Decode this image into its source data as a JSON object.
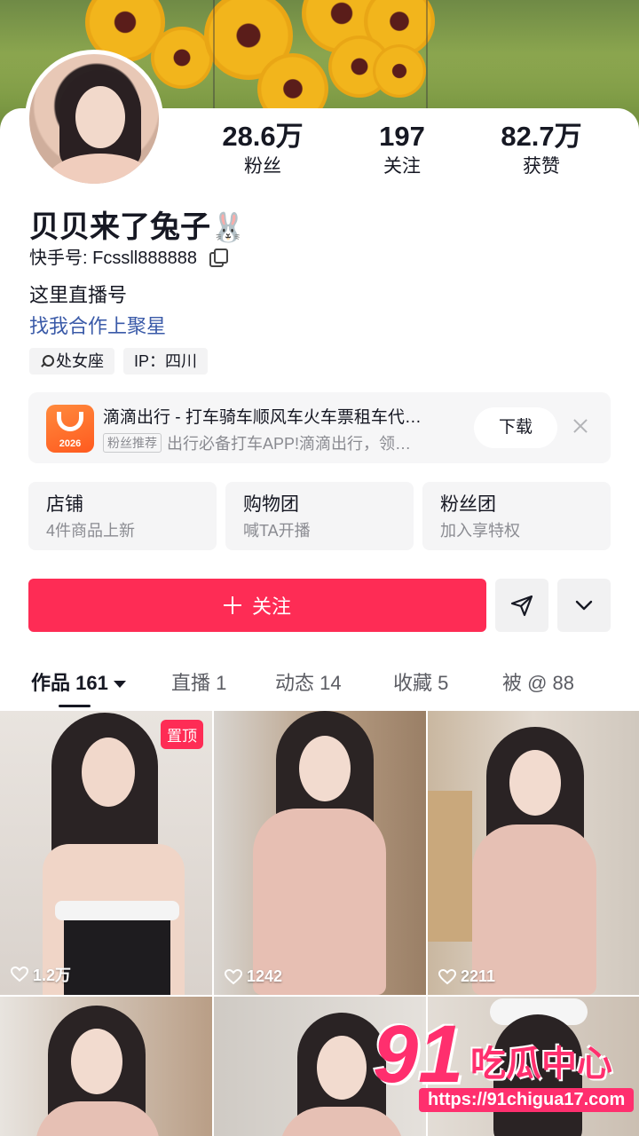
{
  "profile": {
    "name": "贝贝来了兔子",
    "name_emoji": "🐰",
    "kuaishou_id": "快手号: Fcssll888888",
    "bio_line1": "这里直播号",
    "bio_line2": "找我合作上聚星",
    "tags": [
      "处女座",
      "IP：四川"
    ]
  },
  "stats": [
    {
      "value": "28.6万",
      "label": "粉丝"
    },
    {
      "value": "197",
      "label": "关注"
    },
    {
      "value": "82.7万",
      "label": "获赞"
    }
  ],
  "ad": {
    "title": "滴滴出行 - 打车骑车顺风车火车票租车代…",
    "badge": "粉丝推荐",
    "desc": "出行必备打车APP!滴滴出行，领…",
    "button": "下载",
    "logo_year": "2026"
  },
  "features": [
    {
      "title": "店铺",
      "sub": "4件商品上新"
    },
    {
      "title": "购物团",
      "sub": "喊TA开播"
    },
    {
      "title": "粉丝团",
      "sub": "加入享特权"
    }
  ],
  "actions": {
    "follow": "关注"
  },
  "tabs": [
    {
      "label": "作品 161"
    },
    {
      "label": "直播 1"
    },
    {
      "label": "动态 14"
    },
    {
      "label": "收藏 5"
    },
    {
      "label": "被 @ 88"
    }
  ],
  "videos": [
    {
      "likes": "1.2万",
      "pinned": "置顶"
    },
    {
      "likes": "1242"
    },
    {
      "likes": "2211"
    }
  ],
  "watermark": {
    "big": "91",
    "text": "吃瓜中心",
    "url": "https://91chigua17.com"
  },
  "colors": {
    "accent": "#fe2c55",
    "link": "#3a5aa8",
    "muted": "#8a8b91"
  }
}
